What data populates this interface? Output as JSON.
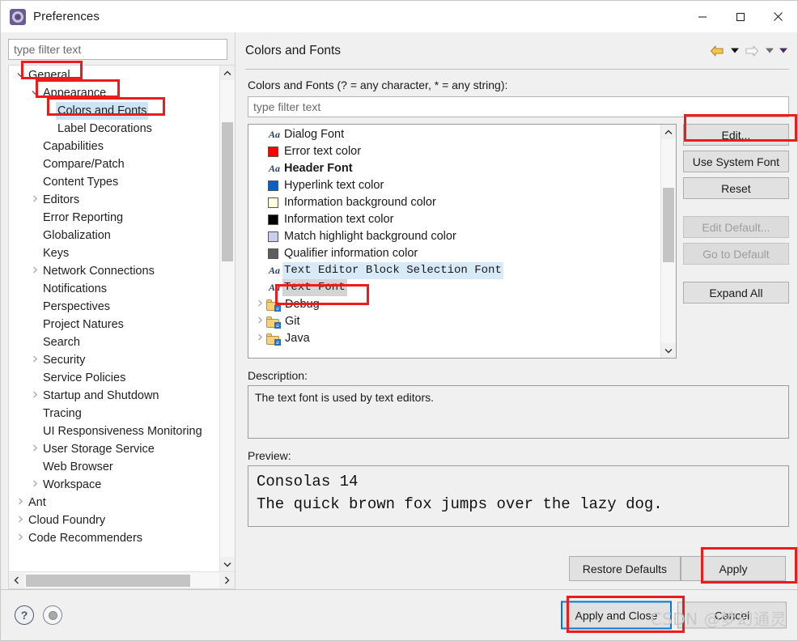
{
  "window": {
    "title": "Preferences",
    "icon": "preferences-gear-icon",
    "controls": {
      "minimize": "—",
      "maximize": "☐",
      "close": "✕"
    }
  },
  "sidebar": {
    "filter_placeholder": "type filter text",
    "filter_value": "",
    "items": [
      {
        "label": "General",
        "indent": 0,
        "twisty": "expanded",
        "selected": false
      },
      {
        "label": "Appearance",
        "indent": 1,
        "twisty": "expanded",
        "selected": false
      },
      {
        "label": "Colors and Fonts",
        "indent": 2,
        "twisty": "none",
        "selected": true
      },
      {
        "label": "Label Decorations",
        "indent": 2,
        "twisty": "none",
        "selected": false
      },
      {
        "label": "Capabilities",
        "indent": 1,
        "twisty": "none",
        "selected": false
      },
      {
        "label": "Compare/Patch",
        "indent": 1,
        "twisty": "none",
        "selected": false
      },
      {
        "label": "Content Types",
        "indent": 1,
        "twisty": "none",
        "selected": false
      },
      {
        "label": "Editors",
        "indent": 1,
        "twisty": "collapsed",
        "selected": false
      },
      {
        "label": "Error Reporting",
        "indent": 1,
        "twisty": "none",
        "selected": false
      },
      {
        "label": "Globalization",
        "indent": 1,
        "twisty": "none",
        "selected": false
      },
      {
        "label": "Keys",
        "indent": 1,
        "twisty": "none",
        "selected": false
      },
      {
        "label": "Network Connections",
        "indent": 1,
        "twisty": "collapsed",
        "selected": false
      },
      {
        "label": "Notifications",
        "indent": 1,
        "twisty": "none",
        "selected": false
      },
      {
        "label": "Perspectives",
        "indent": 1,
        "twisty": "none",
        "selected": false
      },
      {
        "label": "Project Natures",
        "indent": 1,
        "twisty": "none",
        "selected": false
      },
      {
        "label": "Search",
        "indent": 1,
        "twisty": "none",
        "selected": false
      },
      {
        "label": "Security",
        "indent": 1,
        "twisty": "collapsed",
        "selected": false
      },
      {
        "label": "Service Policies",
        "indent": 1,
        "twisty": "none",
        "selected": false
      },
      {
        "label": "Startup and Shutdown",
        "indent": 1,
        "twisty": "collapsed",
        "selected": false
      },
      {
        "label": "Tracing",
        "indent": 1,
        "twisty": "none",
        "selected": false
      },
      {
        "label": "UI Responsiveness Monitoring",
        "indent": 1,
        "twisty": "none",
        "selected": false
      },
      {
        "label": "User Storage Service",
        "indent": 1,
        "twisty": "collapsed",
        "selected": false
      },
      {
        "label": "Web Browser",
        "indent": 1,
        "twisty": "none",
        "selected": false
      },
      {
        "label": "Workspace",
        "indent": 1,
        "twisty": "collapsed",
        "selected": false
      },
      {
        "label": "Ant",
        "indent": 0,
        "twisty": "collapsed",
        "selected": false
      },
      {
        "label": "Cloud Foundry",
        "indent": 0,
        "twisty": "collapsed",
        "selected": false
      },
      {
        "label": "Code Recommenders",
        "indent": 0,
        "twisty": "collapsed",
        "selected": false
      }
    ]
  },
  "page": {
    "title": "Colors and Fonts",
    "nav": {
      "back_icon": "back-arrow-icon",
      "back_menu_icon": "chevron-down-icon",
      "forward_icon": "forward-arrow-icon",
      "forward_menu_icon": "chevron-down-icon",
      "view_menu_icon": "chevron-down-icon"
    },
    "filter_label": "Colors and Fonts (? = any character, * = any string):",
    "filter_placeholder": "type filter text",
    "filter_value": "",
    "list": [
      {
        "label": "Dialog Font",
        "kind": "font",
        "style": "normal",
        "twisty": "none",
        "state": "none"
      },
      {
        "label": "Error text color",
        "kind": "color",
        "color": "#ff0000",
        "twisty": "none",
        "state": "none"
      },
      {
        "label": "Header Font",
        "kind": "font",
        "style": "bold",
        "twisty": "none",
        "state": "none"
      },
      {
        "label": "Hyperlink text color",
        "kind": "color",
        "color": "#0b5fc4",
        "twisty": "none",
        "state": "none"
      },
      {
        "label": "Information background color",
        "kind": "color",
        "color": "#fffee0",
        "twisty": "none",
        "state": "none"
      },
      {
        "label": "Information text color",
        "kind": "color",
        "color": "#000000",
        "twisty": "none",
        "state": "none"
      },
      {
        "label": "Match highlight background color",
        "kind": "color",
        "color": "#ccccee",
        "twisty": "none",
        "state": "none"
      },
      {
        "label": "Qualifier information color",
        "kind": "color",
        "color": "#5e5e5e",
        "twisty": "none",
        "state": "none"
      },
      {
        "label": "Text Editor Block Selection Font",
        "kind": "font",
        "style": "mono",
        "twisty": "none",
        "state": "highlight"
      },
      {
        "label": "Text Font",
        "kind": "font",
        "style": "mono",
        "twisty": "none",
        "state": "selected"
      },
      {
        "label": "Debug",
        "kind": "folder",
        "twisty": "collapsed",
        "state": "none"
      },
      {
        "label": "Git",
        "kind": "folder",
        "twisty": "collapsed",
        "state": "none"
      },
      {
        "label": "Java",
        "kind": "folder",
        "twisty": "collapsed",
        "state": "none"
      }
    ],
    "buttons": [
      {
        "label": "Edit...",
        "enabled": true,
        "name": "edit-button"
      },
      {
        "label": "Use System Font",
        "enabled": true,
        "name": "use-system-font-button"
      },
      {
        "label": "Reset",
        "enabled": true,
        "name": "reset-button"
      },
      {
        "label": "Edit Default...",
        "enabled": false,
        "name": "edit-default-button"
      },
      {
        "label": "Go to Default",
        "enabled": false,
        "name": "go-to-default-button"
      },
      {
        "label": "Expand All",
        "enabled": true,
        "name": "expand-all-button"
      }
    ],
    "description_label": "Description:",
    "description_text": "The text font is used by text editors.",
    "preview_label": "Preview:",
    "preview_line1": "Consolas 14",
    "preview_line2": "The quick brown fox jumps over the lazy dog.",
    "restore_defaults_label": "Restore Defaults",
    "apply_label": "Apply"
  },
  "footer": {
    "help_icon": "help-icon",
    "secondary_icon": "status-circle-icon",
    "apply_and_close_label": "Apply and Close",
    "cancel_label": "Cancel"
  },
  "watermark": "CSDN @梦幻通灵",
  "colors": {
    "accent": "#0078d7",
    "annotation": "#ee1b1b",
    "selection": "#cde4f5",
    "list_highlight": "#d8eaf8",
    "list_selected": "#d4d4d4"
  }
}
